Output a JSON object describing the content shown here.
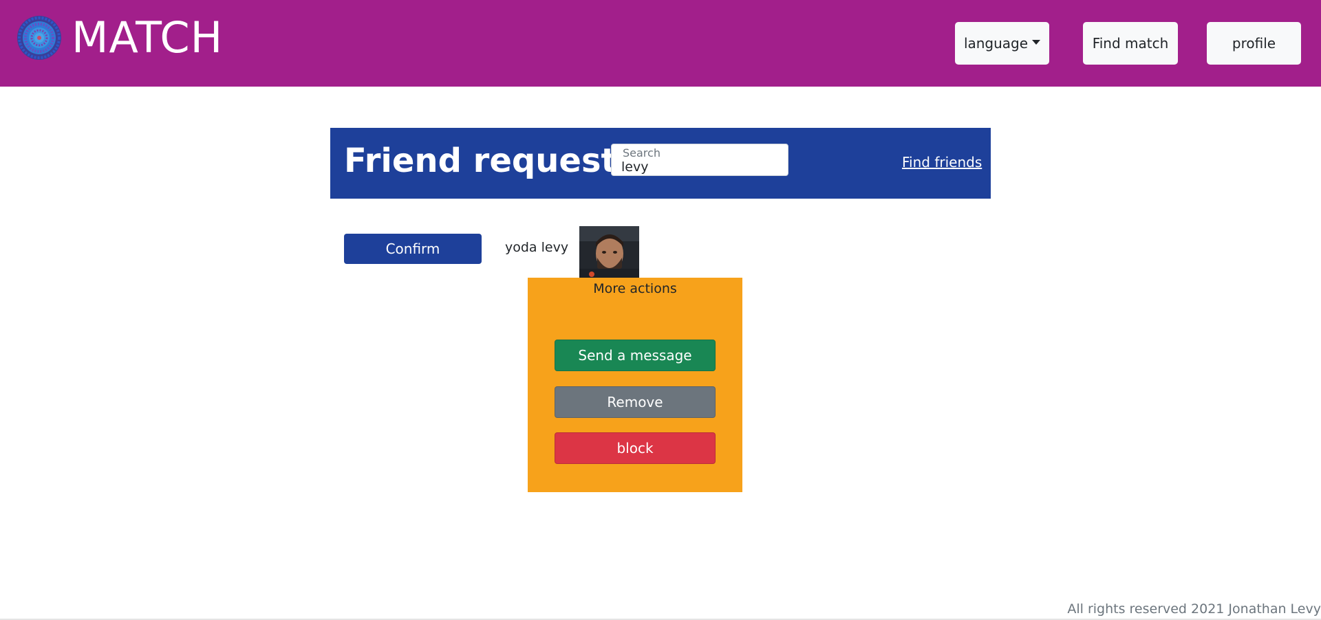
{
  "navbar": {
    "brand": "MATCH",
    "language_label": "language",
    "find_match_label": "Find match",
    "profile_label": "profile",
    "logo_icon": "mandala-logo-icon",
    "colors": {
      "background": "#a21f8b",
      "button": "#f8f9fa"
    }
  },
  "friend_requests": {
    "title": "Friend requests",
    "search_label": "Search",
    "search_value": "levy",
    "find_friends_label": "Find friends",
    "colors": {
      "background": "#1e409a"
    }
  },
  "request": {
    "confirm_label": "Confirm",
    "name": "yoda levy",
    "avatar_icon": "profile-photo"
  },
  "more_actions": {
    "title": "More actions",
    "send_message_label": "Send a message",
    "remove_label": "Remove",
    "block_label": "block",
    "colors": {
      "panel": "#f7a21b",
      "send": "#198754",
      "remove": "#6c757d",
      "block": "#dc3545"
    }
  },
  "footer": {
    "text": "All rights reserved 2021 Jonathan Levy"
  }
}
